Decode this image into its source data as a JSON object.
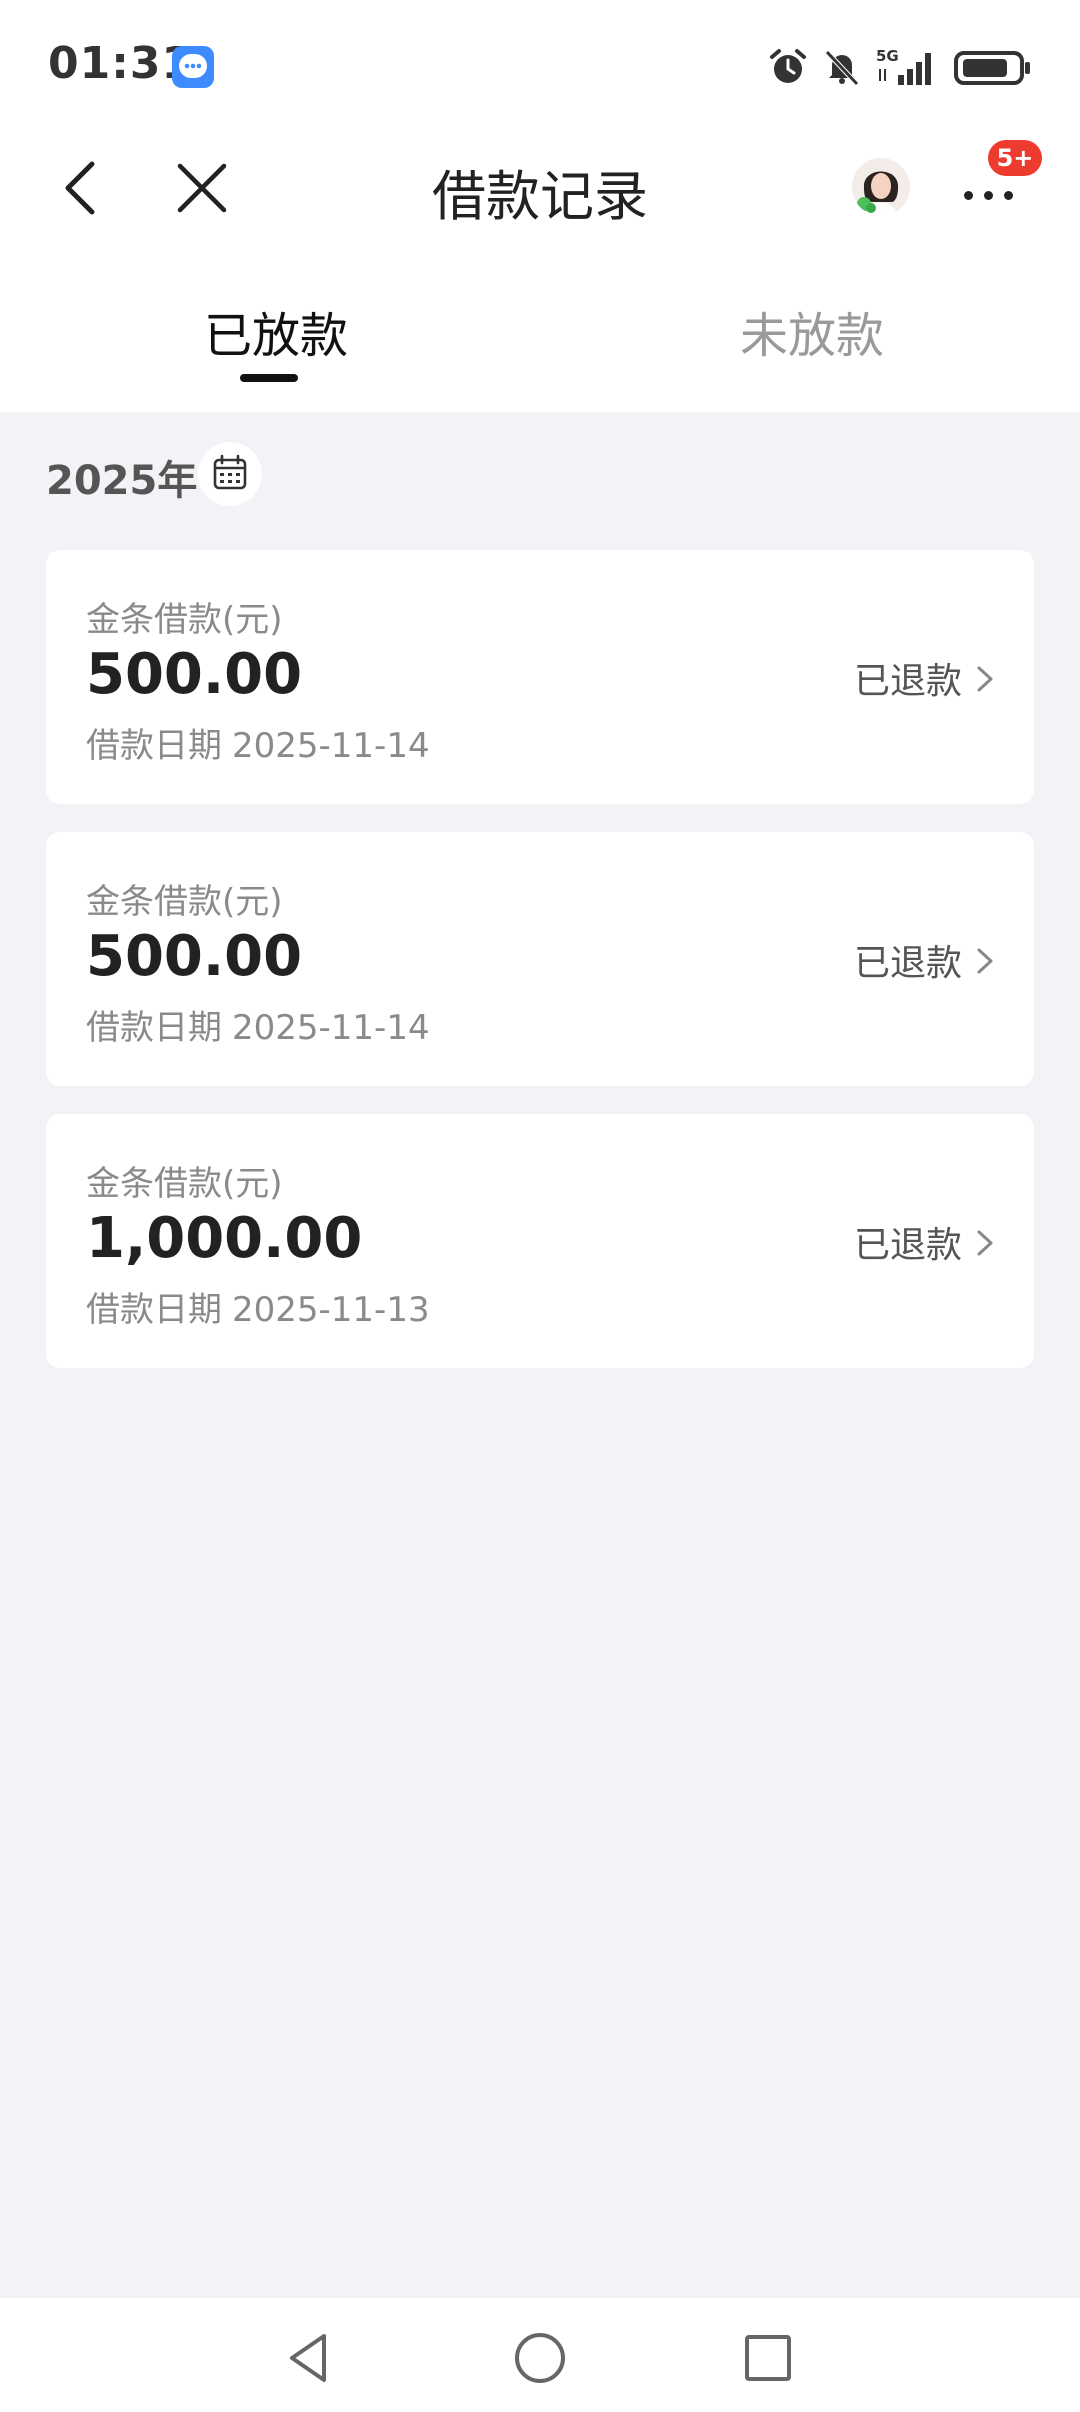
{
  "status_bar": {
    "time": "01:31",
    "icons": [
      "message-icon",
      "alarm-icon",
      "bell-off-icon",
      "5g-signal-icon",
      "battery-icon"
    ]
  },
  "nav": {
    "title": "借款记录",
    "badge": "5+"
  },
  "tabs": [
    {
      "label": "已放款",
      "active": true
    },
    {
      "label": "未放款",
      "active": false
    }
  ],
  "filter": {
    "year": "2025年"
  },
  "records": [
    {
      "label": "金条借款(元)",
      "amount": "500.00",
      "date_label": "借款日期",
      "date": "2025-11-14",
      "status": "已退款"
    },
    {
      "label": "金条借款(元)",
      "amount": "500.00",
      "date_label": "借款日期",
      "date": "2025-11-14",
      "status": "已退款"
    },
    {
      "label": "金条借款(元)",
      "amount": "1,000.00",
      "date_label": "借款日期",
      "date": "2025-11-13",
      "status": "已退款"
    }
  ],
  "colors": {
    "background": "#f2f2f7",
    "card": "#ffffff",
    "badge": "#ee3b2f",
    "muted_text": "#8a8a8a"
  }
}
